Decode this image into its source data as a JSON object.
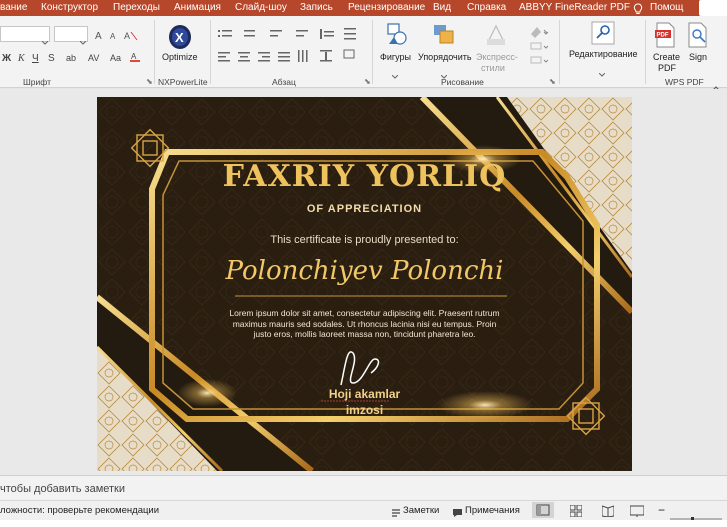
{
  "ribbon_tabs": [
    {
      "label": "вание"
    },
    {
      "label": "Конструктор"
    },
    {
      "label": "Переходы"
    },
    {
      "label": "Анимация"
    },
    {
      "label": "Слайд-шоу"
    },
    {
      "label": "Запись"
    },
    {
      "label": "Рецензирование"
    },
    {
      "label": "Вид"
    },
    {
      "label": "Справка"
    },
    {
      "label": "ABBYY FineReader PDF"
    },
    {
      "label": "Помощ"
    }
  ],
  "groups": {
    "font": "Шрифт",
    "nxpowerlite": "NXPowerLite",
    "paragraph": "Абзац",
    "drawing": "Рисование",
    "wps_pdf": "WPS PDF"
  },
  "buttons": {
    "optimize": "Optimize",
    "shapes": "Фигуры",
    "arrange": "Упорядочить",
    "express_styles_1": "Экспресс-",
    "express_styles_2": "стили",
    "editing": "Редактирование",
    "create_pdf_1": "Create",
    "create_pdf_2": "PDF",
    "sign": "Sign"
  },
  "slide": {
    "title": "FAXRIY YORLIQ",
    "subtitle": "OF APPRECIATION",
    "presented": "This certificate is proudly presented to:",
    "name": "Polonchiyev Polonchi",
    "body_line1": "Lorem ipsum dolor sit amet, consectetur adipiscing elit. Praesent rutrum",
    "body_line2": "maximus mauris sed sodales. Ut rhoncus lacinia nisi eu tempus. Proin",
    "body_line3": "justo eros, mollis laoreet massa non, tincidunt pharetra leo.",
    "signer_line1": "Hoji akamlar",
    "signer_line2": "imzosi"
  },
  "notes_placeholder": "чтобы добавить заметки",
  "status": {
    "accessibility": "ложности: проверьте рекомендации",
    "notes": "Заметки",
    "comments": "Примечания"
  },
  "colors": {
    "ribbon_accent": "#b7472a",
    "gold": "#e3b24a",
    "gold_light": "#f5d98a",
    "slide_dark": "#2a1e11"
  }
}
